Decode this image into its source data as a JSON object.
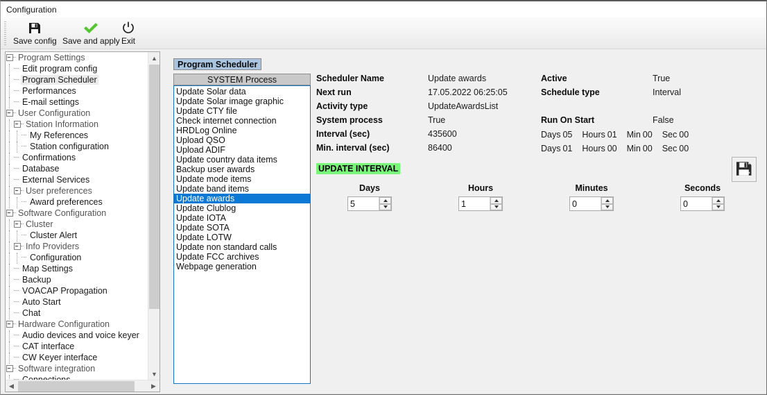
{
  "window": {
    "title": "Configuration"
  },
  "toolbar": {
    "save_config": "Save config",
    "save_and_apply": "Save and apply",
    "exit": "Exit"
  },
  "tree": {
    "items": [
      {
        "label": "Program Settings",
        "depth": 0,
        "type": "group",
        "expander": "minus",
        "selected": false
      },
      {
        "label": "Edit program config",
        "depth": 1,
        "type": "leaf",
        "expander": "dash",
        "selected": false
      },
      {
        "label": "Program Scheduler",
        "depth": 1,
        "type": "leaf",
        "expander": "dash",
        "selected": true
      },
      {
        "label": "Performances",
        "depth": 1,
        "type": "leaf",
        "expander": "dash",
        "selected": false
      },
      {
        "label": "E-mail settings",
        "depth": 1,
        "type": "leaf",
        "expander": "dash",
        "selected": false
      },
      {
        "label": "User Configuration",
        "depth": 0,
        "type": "group",
        "expander": "minus",
        "selected": false
      },
      {
        "label": "Station Information",
        "depth": 1,
        "type": "group",
        "expander": "minus",
        "selected": false
      },
      {
        "label": "My References",
        "depth": 2,
        "type": "leaf",
        "expander": "dash",
        "selected": false
      },
      {
        "label": "Station configuration",
        "depth": 2,
        "type": "leaf",
        "expander": "dash",
        "selected": false
      },
      {
        "label": "Confirmations",
        "depth": 1,
        "type": "leaf",
        "expander": "dash",
        "selected": false
      },
      {
        "label": "Database",
        "depth": 1,
        "type": "leaf",
        "expander": "dash",
        "selected": false
      },
      {
        "label": "External Services",
        "depth": 1,
        "type": "leaf",
        "expander": "dash",
        "selected": false
      },
      {
        "label": "User preferences",
        "depth": 1,
        "type": "group",
        "expander": "minus",
        "selected": false
      },
      {
        "label": "Award preferences",
        "depth": 2,
        "type": "leaf",
        "expander": "dash",
        "selected": false
      },
      {
        "label": "Software Configuration",
        "depth": 0,
        "type": "group",
        "expander": "minus",
        "selected": false
      },
      {
        "label": "Cluster",
        "depth": 1,
        "type": "group",
        "expander": "minus",
        "selected": false
      },
      {
        "label": "Cluster Alert",
        "depth": 2,
        "type": "leaf",
        "expander": "dash",
        "selected": false
      },
      {
        "label": "Info Providers",
        "depth": 1,
        "type": "group",
        "expander": "minus",
        "selected": false
      },
      {
        "label": "Configuration",
        "depth": 2,
        "type": "leaf",
        "expander": "dash",
        "selected": false
      },
      {
        "label": "Map Settings",
        "depth": 1,
        "type": "leaf",
        "expander": "dash",
        "selected": false
      },
      {
        "label": "Backup",
        "depth": 1,
        "type": "leaf",
        "expander": "dash",
        "selected": false
      },
      {
        "label": "VOACAP Propagation",
        "depth": 1,
        "type": "leaf",
        "expander": "dash",
        "selected": false
      },
      {
        "label": "Auto Start",
        "depth": 1,
        "type": "leaf",
        "expander": "dash",
        "selected": false
      },
      {
        "label": "Chat",
        "depth": 1,
        "type": "leaf",
        "expander": "dash",
        "selected": false
      },
      {
        "label": "Hardware Configuration",
        "depth": 0,
        "type": "group",
        "expander": "minus",
        "selected": false
      },
      {
        "label": "Audio devices and voice keyer",
        "depth": 1,
        "type": "leaf",
        "expander": "dash",
        "selected": false
      },
      {
        "label": "CAT interface",
        "depth": 1,
        "type": "leaf",
        "expander": "dash",
        "selected": false
      },
      {
        "label": "CW Keyer interface",
        "depth": 1,
        "type": "leaf",
        "expander": "dash",
        "selected": false
      },
      {
        "label": "Software integration",
        "depth": 0,
        "type": "group",
        "expander": "minus",
        "selected": false
      },
      {
        "label": "Connections",
        "depth": 1,
        "type": "leaf",
        "expander": "dash",
        "selected": false
      }
    ]
  },
  "scheduler": {
    "tab_label": "Program Scheduler",
    "process_header": "SYSTEM Process",
    "processes": [
      {
        "label": "Update Solar data",
        "selected": false
      },
      {
        "label": "Update Solar image graphic",
        "selected": false
      },
      {
        "label": "Update CTY file",
        "selected": false
      },
      {
        "label": "Check internet connection",
        "selected": false
      },
      {
        "label": "HRDLog Online",
        "selected": false
      },
      {
        "label": "Upload QSO",
        "selected": false
      },
      {
        "label": "Upload ADIF",
        "selected": false
      },
      {
        "label": "Update country data items",
        "selected": false
      },
      {
        "label": "Backup user awards",
        "selected": false
      },
      {
        "label": "Update mode items",
        "selected": false
      },
      {
        "label": "Update band items",
        "selected": false
      },
      {
        "label": "Update awards",
        "selected": true
      },
      {
        "label": "Update Clublog",
        "selected": false
      },
      {
        "label": "Update IOTA",
        "selected": false
      },
      {
        "label": "Update SOTA",
        "selected": false
      },
      {
        "label": "Update LOTW",
        "selected": false
      },
      {
        "label": "Update non standard calls",
        "selected": false
      },
      {
        "label": "Update FCC archives",
        "selected": false
      },
      {
        "label": "Webpage generation",
        "selected": false
      }
    ]
  },
  "details": {
    "scheduler_name_label": "Scheduler Name",
    "scheduler_name_value": "Update awards",
    "next_run_label": "Next run",
    "next_run_value": "17.05.2022 06:25:05",
    "activity_type_label": "Activity type",
    "activity_type_value": "UpdateAwardsList",
    "system_process_label": "System process",
    "system_process_value": "True",
    "interval_label": "Interval  (sec)",
    "interval_value": "435600",
    "min_interval_label": "Min. interval  (sec)",
    "min_interval_value": "86400",
    "update_interval_badge": "UPDATE INTERVAL",
    "active_label": "Active",
    "active_value": "True",
    "schedule_type_label": "Schedule type",
    "schedule_type_value": "Interval",
    "run_on_start_label": "Run On Start",
    "run_on_start_value": "False",
    "interval_breakdown": {
      "days_key": "Days",
      "days_val": "05",
      "hours_key": "Hours",
      "hours_val": "01",
      "min_key": "Min",
      "min_val": "00",
      "sec_key": "Sec",
      "sec_val": "00"
    },
    "min_interval_breakdown": {
      "days_key": "Days",
      "days_val": "01",
      "hours_key": "Hours",
      "hours_val": "00",
      "min_key": "Min",
      "min_val": "00",
      "sec_key": "Sec",
      "sec_val": "00"
    }
  },
  "steppers": {
    "days_caption": "Days",
    "days_value": "5",
    "hours_caption": "Hours",
    "hours_value": "1",
    "minutes_caption": "Minutes",
    "minutes_value": "0",
    "seconds_caption": "Seconds",
    "seconds_value": "0"
  },
  "colors": {
    "selection_blue": "#0a78d4",
    "tab_blue": "#a8c4e0",
    "badge_green": "#79f779",
    "listbox_border": "#1577c0",
    "window_bg": "#f0f0f0"
  },
  "icons": {
    "save_config": "floppy-disk-icon",
    "save_and_apply": "green-check-icon",
    "exit": "power-icon",
    "save_interval": "floppy-disk-icon"
  }
}
